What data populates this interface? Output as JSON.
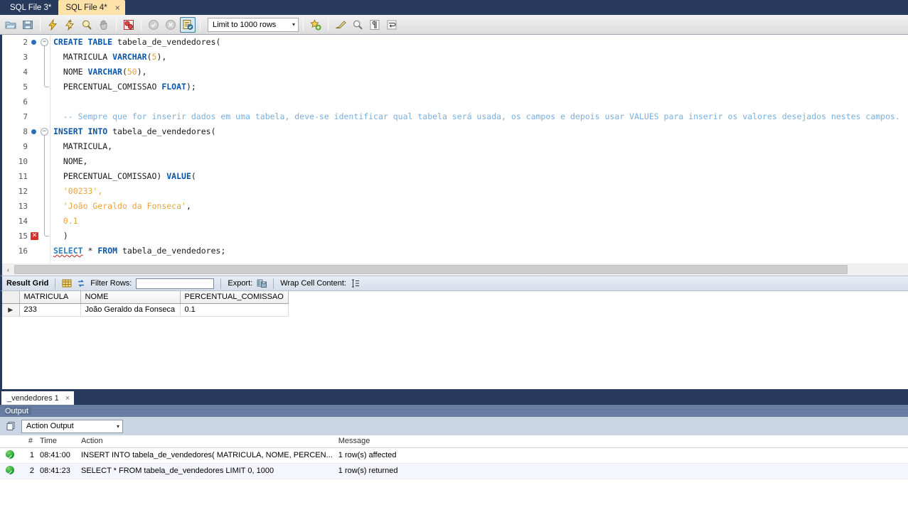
{
  "tabs": [
    {
      "label": "SQL File 3*",
      "active": false,
      "closable": false
    },
    {
      "label": "SQL File 4*",
      "active": true,
      "closable": true,
      "close": "×"
    }
  ],
  "toolbar": {
    "icons": [
      "open-file-icon",
      "save-file-icon",
      "execute-statement-icon",
      "execute-current-statement-icon",
      "explain-query-icon",
      "stop-execution-icon",
      "toggle-stop-on-error-icon",
      "commit-icon",
      "rollback-icon",
      "toggle-autocommit-icon"
    ],
    "limit_label": "Limit to 1000 rows",
    "limit_caret": "▾",
    "right_icons": [
      "beautify-query-icon",
      "find-icon",
      "toggle-invisible-chars-icon",
      "toggle-wrapping-icon"
    ]
  },
  "editor": {
    "lines": [
      {
        "num": "2",
        "marker": "breakpoint",
        "fold": "open",
        "tokens": [
          {
            "t": "CREATE",
            "c": "kw"
          },
          {
            "t": " ",
            "c": "idt"
          },
          {
            "t": "TABLE",
            "c": "kw"
          },
          {
            "t": " tabela_de_vendedores(",
            "c": "idt"
          }
        ]
      },
      {
        "num": "3",
        "marker": "",
        "fold": "",
        "tokens": [
          {
            "t": "  MATRICULA ",
            "c": "idt"
          },
          {
            "t": "VARCHAR",
            "c": "typ"
          },
          {
            "t": "(",
            "c": "idt"
          },
          {
            "t": "5",
            "c": "num"
          },
          {
            "t": "),",
            "c": "idt"
          }
        ]
      },
      {
        "num": "4",
        "marker": "",
        "fold": "",
        "tokens": [
          {
            "t": "  NOME ",
            "c": "idt"
          },
          {
            "t": "VARCHAR",
            "c": "typ"
          },
          {
            "t": "(",
            "c": "idt"
          },
          {
            "t": "50",
            "c": "num"
          },
          {
            "t": "),",
            "c": "idt"
          }
        ]
      },
      {
        "num": "5",
        "marker": "",
        "fold": "end",
        "tokens": [
          {
            "t": "  PERCENTUAL_COMISSAO ",
            "c": "idt"
          },
          {
            "t": "FLOAT",
            "c": "typ"
          },
          {
            "t": ");",
            "c": "idt"
          }
        ]
      },
      {
        "num": "6",
        "marker": "",
        "fold": "",
        "tokens": []
      },
      {
        "num": "7",
        "marker": "",
        "fold": "",
        "tokens": [
          {
            "t": "  -- Sempre que for inserir dados em uma tabela, deve-se identificar qual tabela será usada, os campos e depois usar VALUES para inserir os valores desejados nestes campos.",
            "c": "cmt"
          }
        ]
      },
      {
        "num": "8",
        "marker": "breakpoint",
        "fold": "open",
        "tokens": [
          {
            "t": "INSERT",
            "c": "kw"
          },
          {
            "t": " ",
            "c": "idt"
          },
          {
            "t": "INTO",
            "c": "kw"
          },
          {
            "t": " tabela_de_vendedores(",
            "c": "idt"
          }
        ]
      },
      {
        "num": "9",
        "marker": "",
        "fold": "",
        "tokens": [
          {
            "t": "  MATRICULA,",
            "c": "idt"
          }
        ]
      },
      {
        "num": "10",
        "marker": "",
        "fold": "",
        "tokens": [
          {
            "t": "  NOME,",
            "c": "idt"
          }
        ]
      },
      {
        "num": "11",
        "marker": "",
        "fold": "",
        "tokens": [
          {
            "t": "  PERCENTUAL_COMISSAO) ",
            "c": "idt"
          },
          {
            "t": "VALUE",
            "c": "kw"
          },
          {
            "t": "(",
            "c": "idt"
          }
        ]
      },
      {
        "num": "12",
        "marker": "",
        "fold": "",
        "tokens": [
          {
            "t": "  '00233',",
            "c": "str"
          }
        ]
      },
      {
        "num": "13",
        "marker": "",
        "fold": "",
        "tokens": [
          {
            "t": "  'João Geraldo da Fonseca'",
            "c": "str"
          },
          {
            "t": ",",
            "c": "idt"
          }
        ]
      },
      {
        "num": "14",
        "marker": "",
        "fold": "",
        "tokens": [
          {
            "t": "  0.1",
            "c": "num"
          }
        ]
      },
      {
        "num": "15",
        "marker": "error",
        "fold": "end",
        "tokens": [
          {
            "t": "  )",
            "c": "idt"
          }
        ]
      },
      {
        "num": "16",
        "marker": "",
        "fold": "",
        "tokens": [
          {
            "t": "SELECT",
            "c": "sel"
          },
          {
            "t": " ",
            "c": "idt"
          },
          {
            "t": "*",
            "c": "idt"
          },
          {
            "t": " ",
            "c": "idt"
          },
          {
            "t": "FROM",
            "c": "kw"
          },
          {
            "t": " tabela_de_vendedores;",
            "c": "idt"
          }
        ]
      }
    ],
    "error_glyph": "✕",
    "fold_glyph": "−"
  },
  "scroll": {
    "left_arrow": "‹"
  },
  "result_toolbar": {
    "title": "Result Grid",
    "grid_icon": "result-grid-icon",
    "refresh_icon": "refresh-icon",
    "filter_label": "Filter Rows:",
    "filter_value": "",
    "filter_placeholder": "",
    "export_label": "Export:",
    "export_icon": "export-recordset-icon",
    "wrap_label": "Wrap Cell Content:",
    "wrap_icon": "wrap-cell-icon"
  },
  "result_grid": {
    "columns": [
      "MATRICULA",
      "NOME",
      "PERCENTUAL_COMISSAO"
    ],
    "row_marker": "▶",
    "rows": [
      [
        "233",
        "João Geraldo da Fonseca",
        "0.1"
      ]
    ]
  },
  "result_tab": {
    "label": "_vendedores 1",
    "close": "×"
  },
  "output": {
    "panel_title": "Output",
    "panel_icon": "output-pane-icon",
    "selected_view": "Action Output",
    "caret": "▾",
    "columns": [
      "",
      "#",
      "Time",
      "Action",
      "Message"
    ],
    "rows": [
      {
        "status": "success",
        "index": "1",
        "time": "08:41:00",
        "action": "INSERT INTO tabela_de_vendedores( MATRICULA, NOME, PERCEN...",
        "message": "1 row(s) affected"
      },
      {
        "status": "success",
        "index": "2",
        "time": "08:41:23",
        "action": "SELECT * FROM tabela_de_vendedores LIMIT 0, 1000",
        "message": "1 row(s) returned"
      }
    ]
  },
  "colors": {
    "tabbar_bg": "#283A5B",
    "active_tab_bg": "#FCE2A9",
    "keyword": "#0A56A8",
    "string": "#E8A33D",
    "comment": "#7AAEDC",
    "error": "#D93025",
    "success": "#159A2E"
  }
}
